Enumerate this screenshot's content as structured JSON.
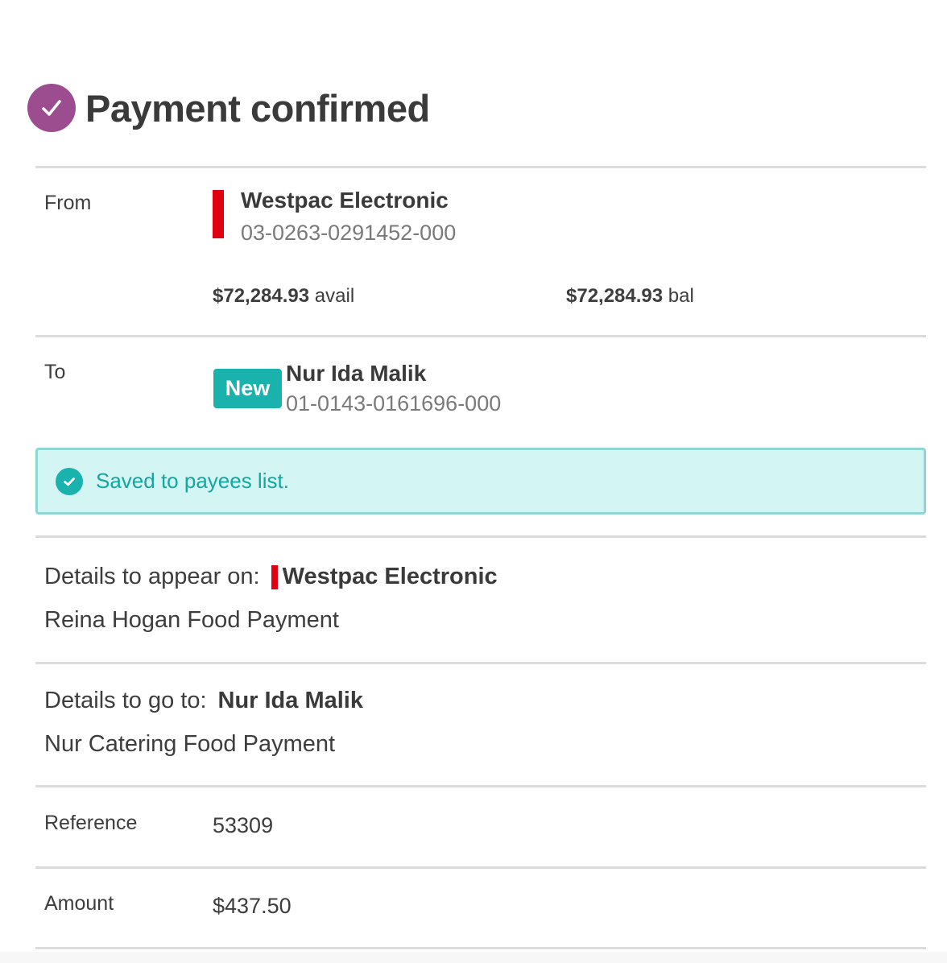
{
  "header": {
    "title": "Payment confirmed",
    "icon": "check-circle-icon",
    "icon_color": "#9b4d8f"
  },
  "from": {
    "label": "From",
    "account_name": "Westpac Electronic",
    "account_number": "03-0263-0291452-000",
    "available_amount": "$72,284.93",
    "available_suffix": " avail",
    "balance_amount": "$72,284.93",
    "balance_suffix": " bal",
    "bank_color": "#e00010"
  },
  "to": {
    "label": "To",
    "badge": "New",
    "payee_name": "Nur Ida Malik",
    "account_number": "01-0143-0161696-000",
    "badge_color": "#1ab2ad"
  },
  "notice": {
    "text": "Saved to payees list.",
    "icon": "check-circle-icon"
  },
  "details_appear": {
    "label": "Details to appear on:",
    "account_name": "Westpac Electronic",
    "text": "Reina Hogan Food Payment"
  },
  "details_go": {
    "label": "Details to go to:",
    "payee_name": "Nur Ida Malik",
    "text": "Nur Catering Food Payment"
  },
  "reference": {
    "label": "Reference",
    "value": "53309"
  },
  "amount": {
    "label": "Amount",
    "value": "$437.50"
  }
}
